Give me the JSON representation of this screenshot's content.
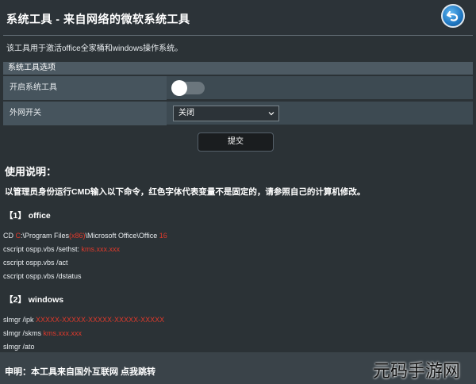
{
  "header": {
    "title": "系统工具 - 来自网络的微软系统工具",
    "back_icon": "back-arrow-icon"
  },
  "description": "该工具用于激活office全家桶和windows操作系统。",
  "panel": {
    "heading": "系统工具选项",
    "rows": [
      {
        "label": "开启系统工具",
        "control": "toggle",
        "state": "off"
      },
      {
        "label": "外网开关",
        "control": "select",
        "value": "关闭"
      }
    ]
  },
  "submit_label": "提交",
  "usage": {
    "title": "使用说明：",
    "instruction": "以管理员身份运行CMD输入以下命令，红色字体代表变量不是固定的，请参照自己的计算机修改。",
    "office": {
      "heading": "【1】 office",
      "lines": [
        {
          "parts": [
            "CD ",
            "C",
            ":\\Program Files",
            "(x86)",
            "\\Microsoft Office\\Office ",
            "16"
          ]
        },
        {
          "parts": [
            "cscript ospp.vbs /sethst: ",
            "kms.xxx.xxx"
          ]
        },
        {
          "parts": [
            "cscript ospp.vbs /act"
          ]
        },
        {
          "parts": [
            "cscript ospp.vbs /dstatus"
          ]
        }
      ]
    },
    "windows": {
      "heading": "【2】 windows",
      "lines": [
        {
          "parts": [
            "slmgr /ipk ",
            "XXXXX-XXXXX-XXXXX-XXXXX-XXXXX"
          ]
        },
        {
          "parts": [
            "slmgr /skms ",
            "kms.xxx.xxx"
          ]
        },
        {
          "parts": [
            "slmgr /ato"
          ]
        }
      ]
    }
  },
  "footer": {
    "text": "申明：本工具来自国外互联网 点我跳转"
  },
  "watermark": "元码手游网",
  "colors": {
    "background": "#2b3236",
    "variable_red": "#e0392b",
    "back_button_blue": "#1f77c2"
  }
}
